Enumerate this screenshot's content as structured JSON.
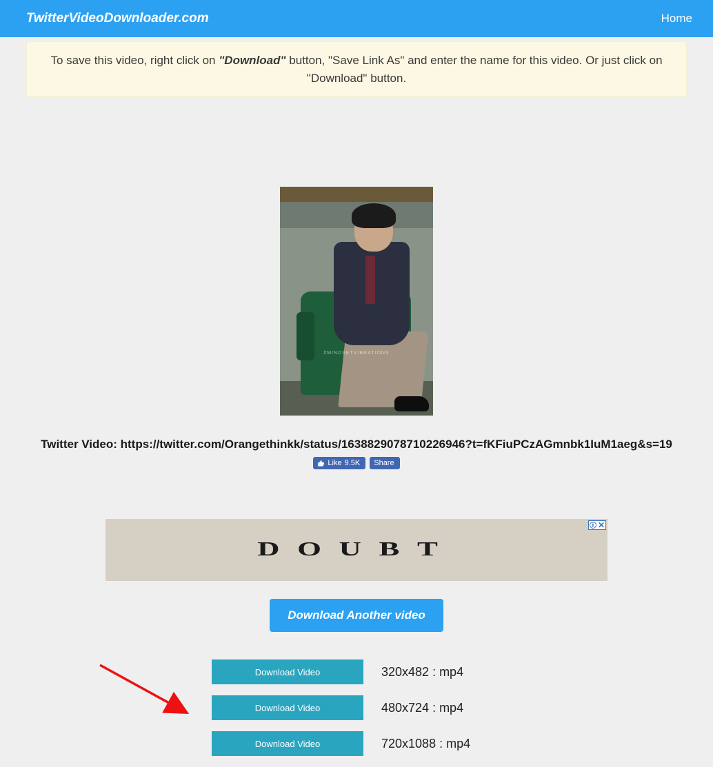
{
  "navbar": {
    "brand": "TwitterVideoDownloader.com",
    "home": "Home"
  },
  "banner": {
    "prefix": "To save this video, right click on ",
    "download_word": "\"Download\"",
    "suffix": " button, \"Save Link As\" and enter the name for this video. Or just click on \"Download\" button."
  },
  "thumbnail": {
    "watermark": "#MINDSETVIBRATIONS"
  },
  "video_url_label": "Twitter Video: https://twitter.com/Orangethinkk/status/1638829078710226946?t=fKFiuPCzAGmnbk1IuM1aeg&s=19",
  "facebook": {
    "like_label": "Like",
    "like_count": "9.5K",
    "share_label": "Share"
  },
  "ad": {
    "text": "DOUBT",
    "info": "i",
    "close": "✕"
  },
  "another_button": "Download Another video",
  "downloads": [
    {
      "label": "Download Video",
      "format": "320x482 : mp4"
    },
    {
      "label": "Download Video",
      "format": "480x724 : mp4"
    },
    {
      "label": "Download Video",
      "format": "720x1088 : mp4"
    }
  ]
}
